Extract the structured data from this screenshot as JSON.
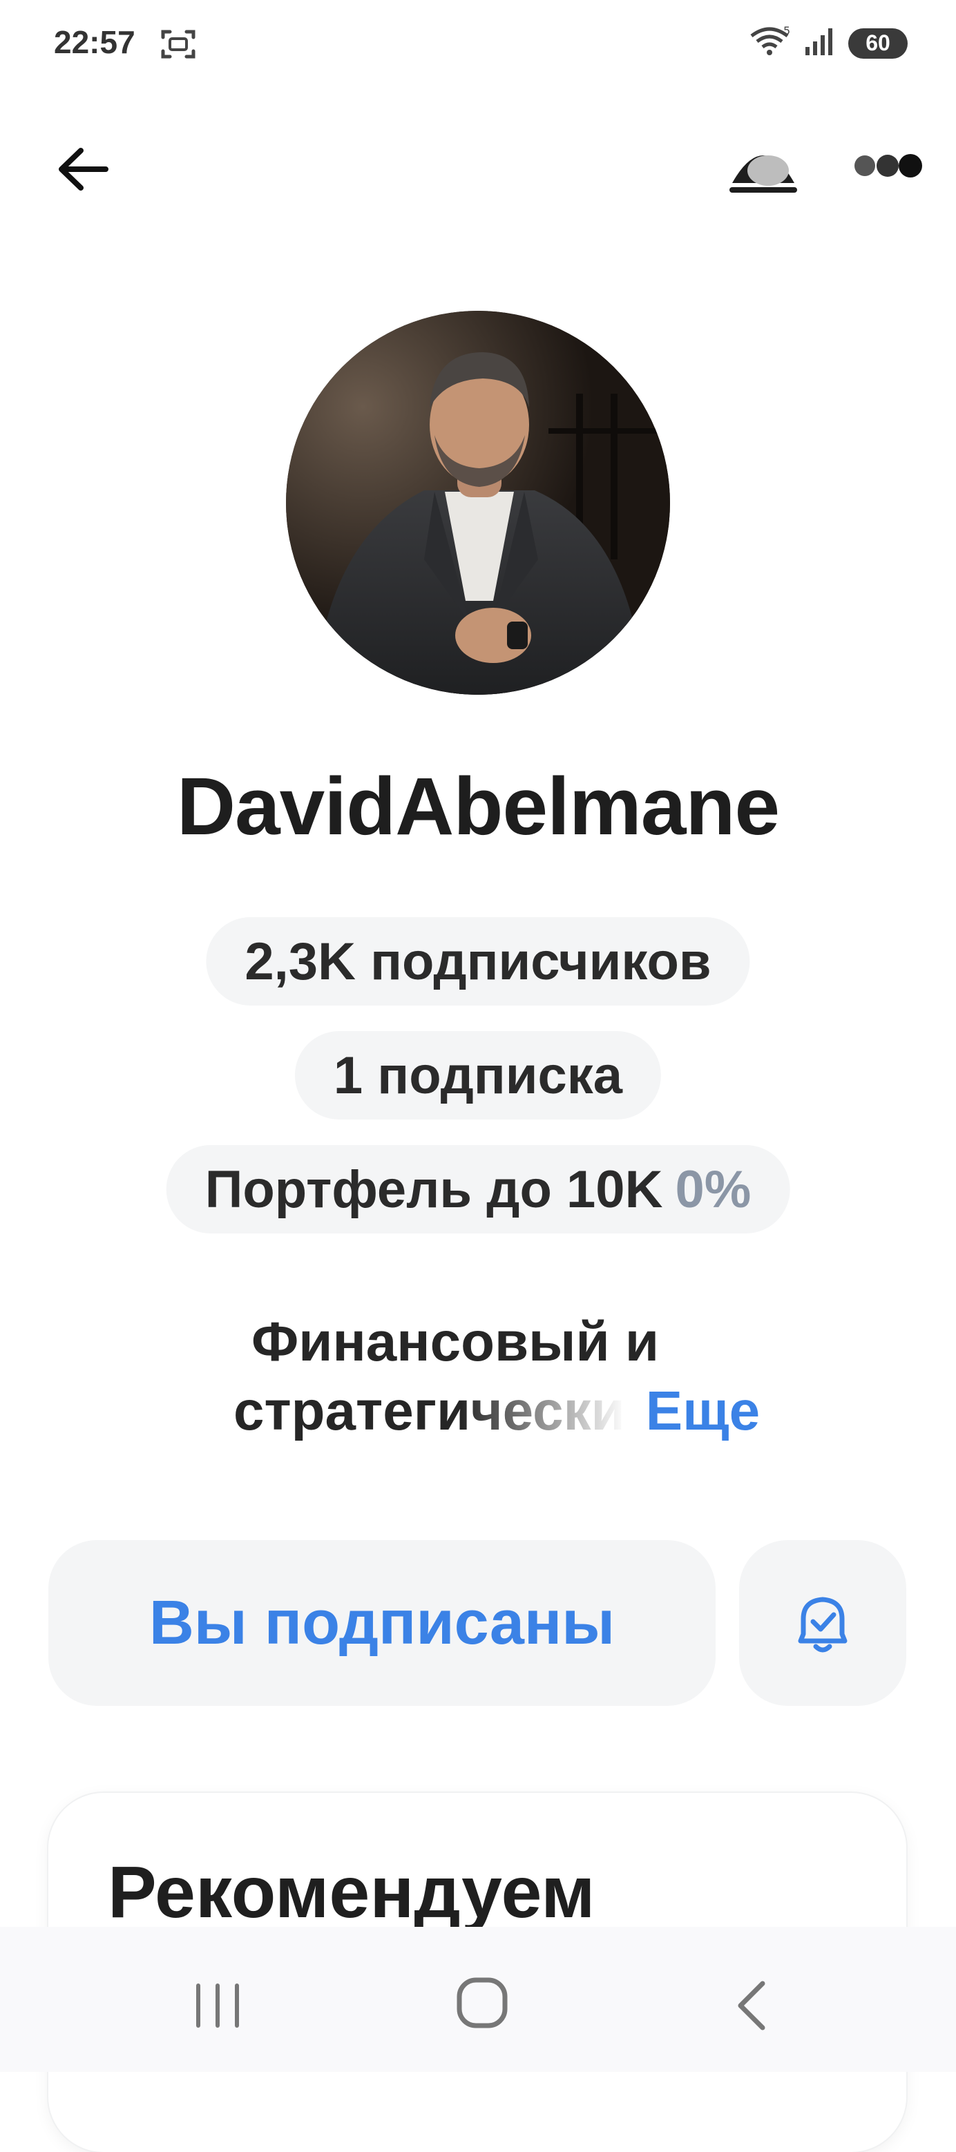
{
  "status_bar": {
    "time": "22:57",
    "battery": "60",
    "icons": [
      "screenshot-icon",
      "wifi-icon",
      "signal-icon",
      "battery-icon"
    ]
  },
  "header": {
    "back_icon": "arrow-left-icon",
    "portfolio_icon": "portfolio-icon",
    "more_icon": "more-dots-icon"
  },
  "profile": {
    "username": "DavidAbelmane",
    "followers": "2,3K подписчиков",
    "following": "1 подписка",
    "portfolio_label": "Портфель до 10K",
    "portfolio_pct": "0%",
    "bio_line1": "Финансовый и",
    "bio_line2": "стратегически",
    "bio_more": "Еще"
  },
  "actions": {
    "subscribe_label": "Вы подписаны",
    "bell_icon": "bell-check-icon"
  },
  "recommendations": {
    "title": "Рекомендуем"
  },
  "colors": {
    "accent": "#3b82e6",
    "chip_bg": "#f4f5f6",
    "muted_pct": "#8b96a6"
  }
}
